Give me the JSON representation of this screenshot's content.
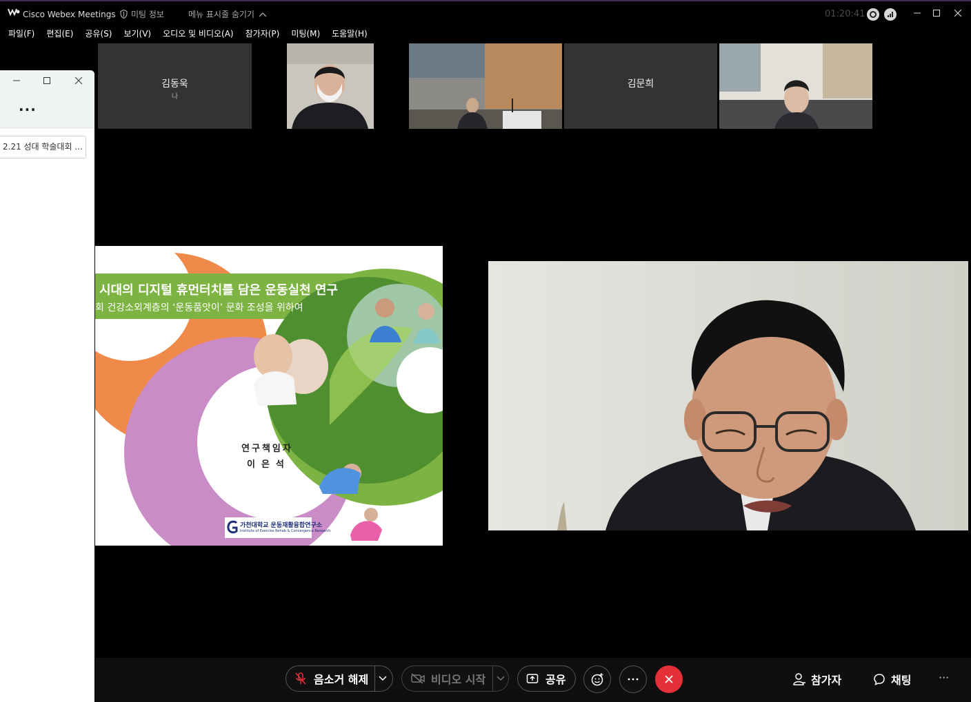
{
  "titlebar": {
    "app_title": "Cisco Webex Meetings",
    "meeting_info": "미팅 정보",
    "hide_menu": "메뉴 표시줄 숨기기",
    "timer": "01:20:41"
  },
  "menu": {
    "items": [
      "파일(F)",
      "편집(E)",
      "공유(S)",
      "보기(V)",
      "오디오 및 비디오(A)",
      "참가자(P)",
      "미팅(M)",
      "도움말(H)"
    ]
  },
  "thumbnails": [
    {
      "name": "김동욱",
      "sub": "나"
    },
    {
      "name": ""
    },
    {
      "name": ""
    },
    {
      "name": "김문희"
    },
    {
      "name": ""
    }
  ],
  "side_panel": {
    "dots": "...",
    "item": "2.21 성대 학술대회 ..."
  },
  "slide": {
    "title": "시대의 디지털 휴먼터치를 담은 운동실천 연구",
    "subtitle": "회 건강소외계층의 ‘운동품앗이’ 문화 조성을 위하여",
    "role": "연구책임자",
    "name": "이은석",
    "logo_ko": "가천대학교 운동재활융합연구소",
    "logo_en": "Institute of Exercise Rehab & Convergence Research"
  },
  "controls": {
    "mute": "음소거 해제",
    "video": "비디오 시작",
    "share": "공유",
    "participants": "참가자",
    "chat": "채팅",
    "more": "···"
  },
  "colors": {
    "end_call": "#e5303a",
    "slide_green": "#7cb342",
    "slide_orange": "#f08a4b",
    "slide_purple": "#c98cc6"
  }
}
